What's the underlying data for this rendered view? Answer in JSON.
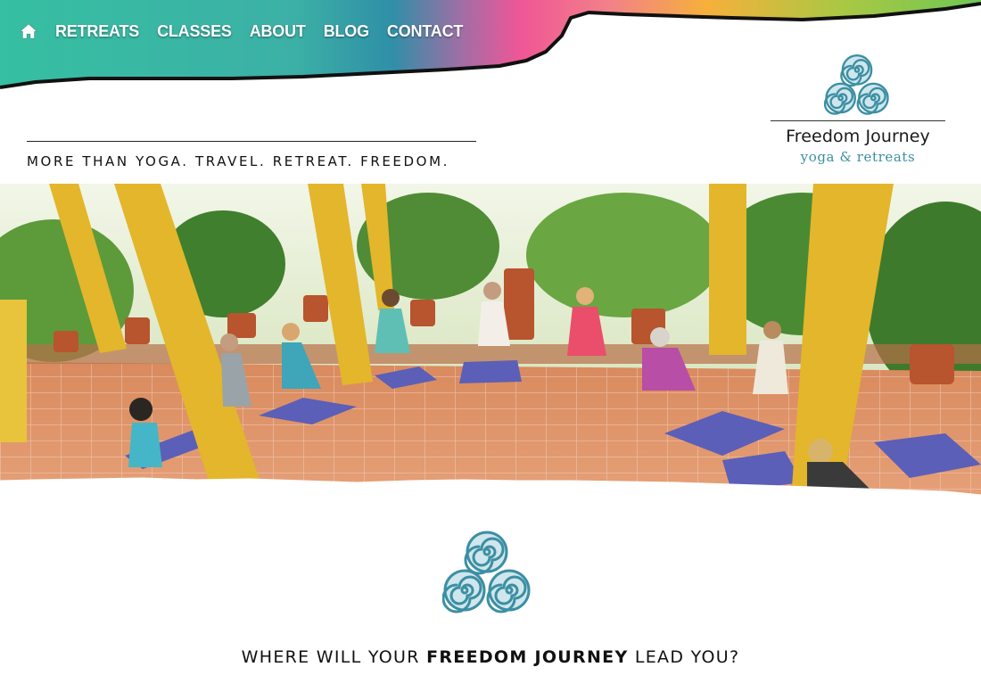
{
  "nav": {
    "home_icon": "home-icon",
    "items": [
      {
        "label": "RETREATS"
      },
      {
        "label": "CLASSES"
      },
      {
        "label": "ABOUT"
      },
      {
        "label": "BLOG"
      },
      {
        "label": "CONTACT"
      }
    ]
  },
  "brand": {
    "name": "Freedom Journey",
    "subtitle": "yoga & retreats",
    "logo_icon": "triple-spiral-icon",
    "accent_color": "#3b8fa3"
  },
  "tagline": "MORE THAN YOGA. TRAVEL. RETREAT. FREEDOM.",
  "hero": {
    "image": "yoga-class-on-terrace-photo"
  },
  "cta": {
    "prefix": "WHERE WILL YOUR ",
    "emphasis": "FREEDOM JOURNEY",
    "suffix": " LEAD YOU?"
  },
  "colors": {
    "banner_gradient": [
      "#3dbfa4",
      "#2f93a6",
      "#ef5a9a",
      "#f4a53a",
      "#7cc64a"
    ]
  }
}
